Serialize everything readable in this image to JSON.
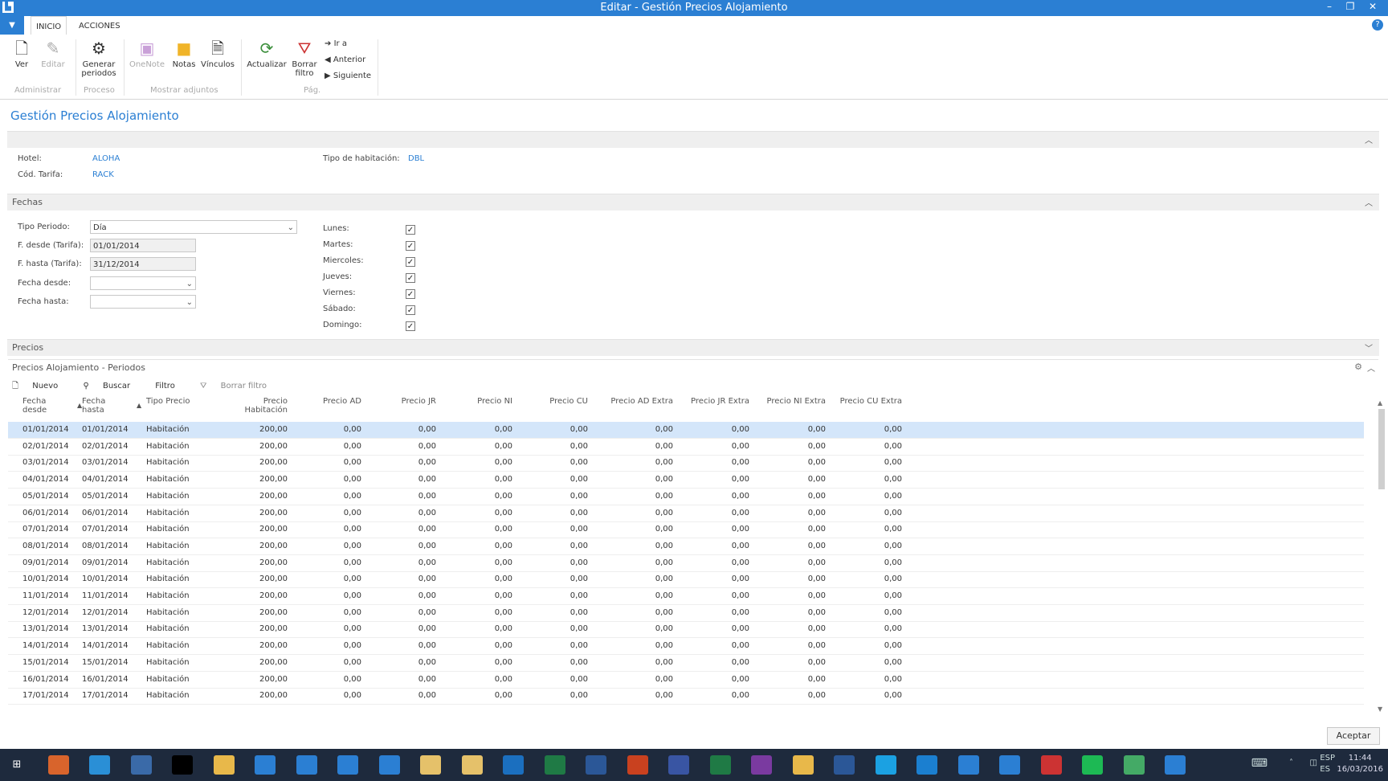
{
  "window": {
    "title": "Editar - Gestión Precios Alojamiento"
  },
  "ribbon_tabs": [
    "INICIO",
    "ACCIONES"
  ],
  "ribbon": {
    "ver": "Ver",
    "editar": "Editar",
    "generar_1": "Generar",
    "generar_2": "periodos",
    "onenote": "OneNote",
    "notas": "Notas",
    "vinculos": "Vínculos",
    "actualizar": "Actualizar",
    "borrar_1": "Borrar",
    "borrar_2": "filtro",
    "ir_a": "Ir a",
    "anterior": "Anterior",
    "siguiente": "Siguiente",
    "grp_administrar": "Administrar",
    "grp_proceso": "Proceso",
    "grp_adjuntos": "Mostrar adjuntos",
    "grp_pag": "Pág."
  },
  "page_title": "Gestión Precios Alojamiento",
  "general": {
    "hotel_label": "Hotel:",
    "hotel_value": "ALOHA",
    "tarifa_label": "Cód. Tarifa:",
    "tarifa_value": "RACK",
    "tipo_hab_label": "Tipo de habitación:",
    "tipo_hab_value": "DBL"
  },
  "fechas": {
    "section": "Fechas",
    "tipo_periodo_label": "Tipo Periodo:",
    "tipo_periodo_value": "Día",
    "desde_tarifa_label": "F. desde (Tarifa):",
    "desde_tarifa_value": "01/01/2014",
    "hasta_tarifa_label": "F. hasta (Tarifa):",
    "hasta_tarifa_value": "31/12/2014",
    "fecha_desde_label": "Fecha desde:",
    "fecha_hasta_label": "Fecha hasta:",
    "days": [
      "Lunes:",
      "Martes:",
      "Miercoles:",
      "Jueves:",
      "Viernes:",
      "Sábado:",
      "Domingo:"
    ],
    "checked": "✓"
  },
  "precios": {
    "section": "Precios",
    "subpart_title": "Precios Alojamiento - Periodos",
    "tools": {
      "nuevo": "Nuevo",
      "buscar": "Buscar",
      "filtro": "Filtro",
      "borrar_filtro": "Borrar filtro"
    },
    "columns": [
      [
        "Fecha",
        "desde"
      ],
      [
        "Fecha",
        "hasta"
      ],
      [
        "Tipo Precio",
        ""
      ],
      [
        "Precio",
        "Habitación"
      ],
      [
        "Precio AD",
        ""
      ],
      [
        "Precio JR",
        ""
      ],
      [
        "Precio NI",
        ""
      ],
      [
        "Precio CU",
        ""
      ],
      [
        "Precio AD Extra",
        ""
      ],
      [
        "Precio JR Extra",
        ""
      ],
      [
        "Precio NI Extra",
        ""
      ],
      [
        "Precio CU Extra",
        ""
      ]
    ],
    "rows": [
      [
        "01/01/2014",
        "01/01/2014",
        "Habitación",
        "200,00",
        "0,00",
        "0,00",
        "0,00",
        "0,00",
        "0,00",
        "0,00",
        "0,00",
        "0,00"
      ],
      [
        "02/01/2014",
        "02/01/2014",
        "Habitación",
        "200,00",
        "0,00",
        "0,00",
        "0,00",
        "0,00",
        "0,00",
        "0,00",
        "0,00",
        "0,00"
      ],
      [
        "03/01/2014",
        "03/01/2014",
        "Habitación",
        "200,00",
        "0,00",
        "0,00",
        "0,00",
        "0,00",
        "0,00",
        "0,00",
        "0,00",
        "0,00"
      ],
      [
        "04/01/2014",
        "04/01/2014",
        "Habitación",
        "200,00",
        "0,00",
        "0,00",
        "0,00",
        "0,00",
        "0,00",
        "0,00",
        "0,00",
        "0,00"
      ],
      [
        "05/01/2014",
        "05/01/2014",
        "Habitación",
        "200,00",
        "0,00",
        "0,00",
        "0,00",
        "0,00",
        "0,00",
        "0,00",
        "0,00",
        "0,00"
      ],
      [
        "06/01/2014",
        "06/01/2014",
        "Habitación",
        "200,00",
        "0,00",
        "0,00",
        "0,00",
        "0,00",
        "0,00",
        "0,00",
        "0,00",
        "0,00"
      ],
      [
        "07/01/2014",
        "07/01/2014",
        "Habitación",
        "200,00",
        "0,00",
        "0,00",
        "0,00",
        "0,00",
        "0,00",
        "0,00",
        "0,00",
        "0,00"
      ],
      [
        "08/01/2014",
        "08/01/2014",
        "Habitación",
        "200,00",
        "0,00",
        "0,00",
        "0,00",
        "0,00",
        "0,00",
        "0,00",
        "0,00",
        "0,00"
      ],
      [
        "09/01/2014",
        "09/01/2014",
        "Habitación",
        "200,00",
        "0,00",
        "0,00",
        "0,00",
        "0,00",
        "0,00",
        "0,00",
        "0,00",
        "0,00"
      ],
      [
        "10/01/2014",
        "10/01/2014",
        "Habitación",
        "200,00",
        "0,00",
        "0,00",
        "0,00",
        "0,00",
        "0,00",
        "0,00",
        "0,00",
        "0,00"
      ],
      [
        "11/01/2014",
        "11/01/2014",
        "Habitación",
        "200,00",
        "0,00",
        "0,00",
        "0,00",
        "0,00",
        "0,00",
        "0,00",
        "0,00",
        "0,00"
      ],
      [
        "12/01/2014",
        "12/01/2014",
        "Habitación",
        "200,00",
        "0,00",
        "0,00",
        "0,00",
        "0,00",
        "0,00",
        "0,00",
        "0,00",
        "0,00"
      ],
      [
        "13/01/2014",
        "13/01/2014",
        "Habitación",
        "200,00",
        "0,00",
        "0,00",
        "0,00",
        "0,00",
        "0,00",
        "0,00",
        "0,00",
        "0,00"
      ],
      [
        "14/01/2014",
        "14/01/2014",
        "Habitación",
        "200,00",
        "0,00",
        "0,00",
        "0,00",
        "0,00",
        "0,00",
        "0,00",
        "0,00",
        "0,00"
      ],
      [
        "15/01/2014",
        "15/01/2014",
        "Habitación",
        "200,00",
        "0,00",
        "0,00",
        "0,00",
        "0,00",
        "0,00",
        "0,00",
        "0,00",
        "0,00"
      ],
      [
        "16/01/2014",
        "16/01/2014",
        "Habitación",
        "200,00",
        "0,00",
        "0,00",
        "0,00",
        "0,00",
        "0,00",
        "0,00",
        "0,00",
        "0,00"
      ],
      [
        "17/01/2014",
        "17/01/2014",
        "Habitación",
        "200,00",
        "0,00",
        "0,00",
        "0,00",
        "0,00",
        "0,00",
        "0,00",
        "0,00",
        "0,00"
      ]
    ]
  },
  "footer": {
    "aceptar": "Aceptar"
  },
  "taskbar": {
    "icons": [
      "windows-icon",
      "firefox-icon",
      "ie-icon",
      "app-icon",
      "cmd-icon",
      "explorer-icon",
      "chart-app-icon",
      "nav-icon",
      "chart-app-icon",
      "chart-app-icon",
      "folder-icon",
      "folder-icon",
      "outlook-icon",
      "excel-icon",
      "word-icon",
      "powerpoint-icon",
      "visio-icon",
      "publisher-icon",
      "onenote-icon",
      "powerbi-icon",
      "browser-icon",
      "skype-icon",
      "teamviewer-icon",
      "app-icon",
      "app-icon",
      "app-icon",
      "spotify-icon",
      "app-icon",
      "app-icon"
    ],
    "lang_1": "ESP",
    "lang_2": "ES",
    "time": "11:44",
    "date": "16/03/2016"
  },
  "colors": {
    "accent": "#2b7fd3",
    "selected_row": "#d4e6fa",
    "taskbar": "#1e2a3d"
  }
}
